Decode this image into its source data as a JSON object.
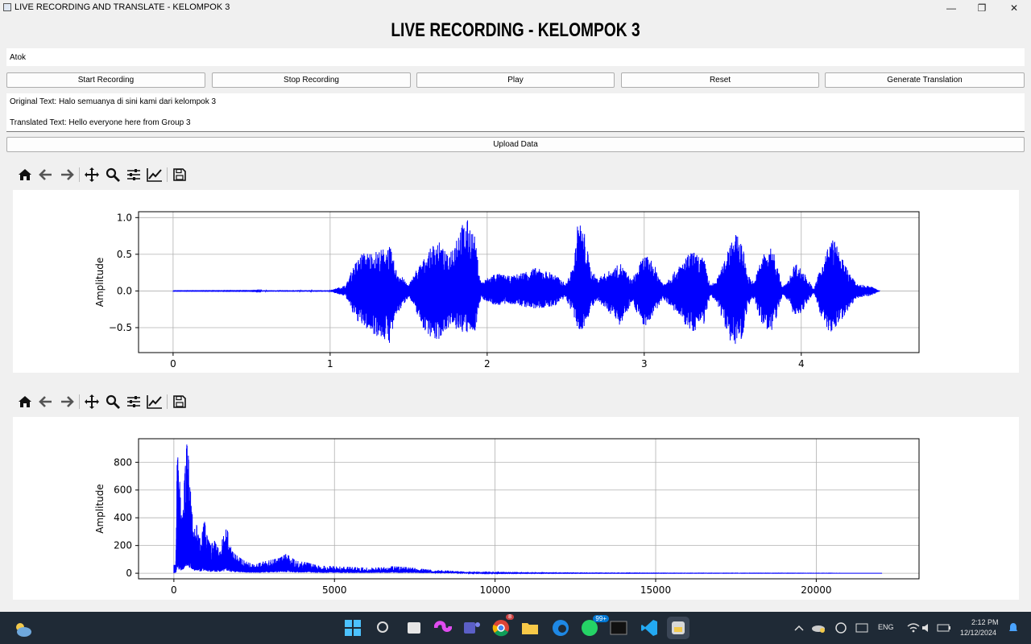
{
  "window": {
    "title": "LIVE RECORDING AND TRANSLATE - KELOMPOK 3",
    "minimize_glyph": "—",
    "restore_glyph": "❐",
    "close_glyph": "✕"
  },
  "heading": "LIVE RECORDING - KELOMPOK 3",
  "name_field": {
    "value": "Atok"
  },
  "buttons": {
    "start": "Start Recording",
    "stop": "Stop Recording",
    "play": "Play",
    "reset": "Reset",
    "generate": "Generate Translation",
    "upload": "Upload Data"
  },
  "output": {
    "original": "Original Text: Halo semuanya di sini kami dari kelompok 3",
    "translated": "Translated Text: Hello everyone here from Group 3"
  },
  "toolbar_icons": [
    "home-icon",
    "back-icon",
    "forward-icon",
    "pan-icon",
    "zoom-icon",
    "configure-subplots-icon",
    "edit-axis-icon",
    "save-icon"
  ],
  "colors": {
    "series": "#0000ff",
    "grid": "#b0b0b0",
    "taskbar": "#1f2a36"
  },
  "chart_data": [
    {
      "type": "line",
      "title": "",
      "xlabel": "",
      "ylabel": "Amplitude",
      "xlim": [
        -0.22,
        4.75
      ],
      "ylim": [
        -0.84,
        1.08
      ],
      "xticks": [
        "0",
        "1",
        "2",
        "3",
        "4"
      ],
      "yticks": [
        "−0.5",
        "0.0",
        "0.5",
        "1.0"
      ],
      "grid": true,
      "series": [
        {
          "color": "#0000ff",
          "envelope": {
            "t": [
              0,
              0.5,
              0.6,
              1.0,
              1.1,
              1.15,
              1.2,
              1.3,
              1.38,
              1.42,
              1.5,
              1.55,
              1.6,
              1.68,
              1.75,
              1.82,
              1.88,
              1.92,
              1.96,
              2.05,
              2.15,
              2.3,
              2.42,
              2.5,
              2.55,
              2.58,
              2.62,
              2.66,
              2.7,
              2.78,
              2.85,
              2.92,
              3.0,
              3.05,
              3.12,
              3.2,
              3.3,
              3.38,
              3.42,
              3.46,
              3.5,
              3.56,
              3.62,
              3.66,
              3.7,
              3.75,
              3.82,
              3.88,
              3.92,
              3.96,
              4.02,
              4.08,
              4.12,
              4.16,
              4.2,
              4.27,
              4.35,
              4.45,
              4.5
            ],
            "top": [
              0.002,
              0.003,
              0.01,
              0.01,
              0.08,
              0.35,
              0.52,
              0.55,
              0.62,
              0.3,
              0.08,
              0.3,
              0.45,
              0.72,
              0.48,
              0.88,
              0.98,
              0.75,
              0.12,
              0.25,
              0.2,
              0.32,
              0.25,
              0.1,
              0.35,
              1.0,
              0.8,
              0.3,
              0.18,
              0.28,
              0.38,
              0.15,
              0.5,
              0.42,
              0.1,
              0.28,
              0.55,
              0.45,
              0.08,
              0.15,
              0.35,
              0.82,
              0.7,
              0.22,
              0.12,
              0.5,
              0.6,
              0.05,
              0.15,
              0.4,
              0.25,
              0.02,
              0.3,
              0.55,
              0.75,
              0.4,
              0.1,
              0.06,
              0.0
            ],
            "bottom": [
              -0.002,
              -0.003,
              -0.01,
              -0.01,
              -0.08,
              -0.35,
              -0.48,
              -0.62,
              -0.72,
              -0.35,
              -0.08,
              -0.3,
              -0.55,
              -0.7,
              -0.5,
              -0.55,
              -0.6,
              -0.58,
              -0.1,
              -0.2,
              -0.18,
              -0.25,
              -0.22,
              -0.1,
              -0.35,
              -0.58,
              -0.5,
              -0.25,
              -0.15,
              -0.3,
              -0.48,
              -0.15,
              -0.5,
              -0.38,
              -0.1,
              -0.3,
              -0.58,
              -0.45,
              -0.08,
              -0.15,
              -0.4,
              -0.75,
              -0.7,
              -0.2,
              -0.12,
              -0.48,
              -0.58,
              -0.05,
              -0.15,
              -0.38,
              -0.25,
              -0.02,
              -0.3,
              -0.55,
              -0.58,
              -0.35,
              -0.1,
              -0.06,
              0.0
            ]
          }
        }
      ]
    },
    {
      "type": "line",
      "title": "",
      "xlabel": "",
      "ylabel": "Amplitude",
      "xlim": [
        -1100,
        23200
      ],
      "ylim": [
        -40,
        970
      ],
      "xticks": [
        "0",
        "5000",
        "10000",
        "15000",
        "20000"
      ],
      "yticks": [
        "0",
        "200",
        "400",
        "600",
        "800"
      ],
      "grid": true,
      "series": [
        {
          "color": "#0000ff",
          "spikes": {
            "x": [
              60,
              100,
              130,
              160,
              190,
              220,
              250,
              300,
              350,
              400,
              430,
              460,
              500,
              560,
              620,
              700,
              780,
              860,
              950,
              1050,
              1150,
              1250,
              1400,
              1550,
              1650,
              1800,
              2000,
              2200,
              2500,
              2800,
              3100,
              3300,
              3500,
              3800,
              4100,
              4500,
              5000,
              5500,
              6000,
              6500,
              6800,
              7200,
              7800,
              8500,
              9300,
              10500,
              13000,
              16000,
              19000,
              22050
            ],
            "y": [
              60,
              780,
              850,
              500,
              700,
              380,
              460,
              560,
              740,
              930,
              900,
              820,
              600,
              560,
              300,
              360,
              250,
              260,
              380,
              250,
              200,
              240,
              170,
              270,
              330,
              160,
              120,
              90,
              60,
              85,
              100,
              110,
              140,
              90,
              80,
              55,
              50,
              45,
              40,
              42,
              50,
              45,
              30,
              20,
              8,
              4,
              2,
              1,
              1,
              0
            ]
          }
        }
      ]
    }
  ],
  "taskbar": {
    "whatsapp_badge": "99+",
    "chrome_badge": "8",
    "lang": "ENG",
    "time": "2:12 PM",
    "date": "12/12/2024"
  }
}
